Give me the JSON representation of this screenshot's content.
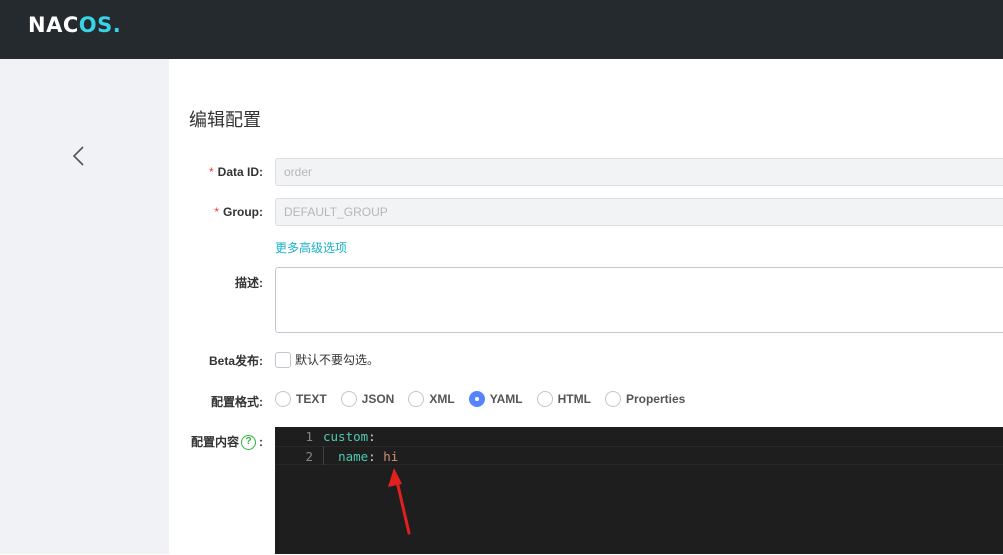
{
  "header": {
    "logo_text_a": "NAC",
    "logo_text_b": "OS",
    "logo_dot": "."
  },
  "sidebar": {
    "back_icon": "chevron-left-icon"
  },
  "page": {
    "title": "编辑配置"
  },
  "form": {
    "data_id": {
      "required_mark": "*",
      "label": "Data ID:",
      "value": "order"
    },
    "group": {
      "required_mark": "*",
      "label": "Group:",
      "value": "DEFAULT_GROUP"
    },
    "advanced_link": "更多高级选项",
    "description": {
      "label": "描述:",
      "value": ""
    },
    "beta": {
      "label": "Beta发布:",
      "checkbox_text": "默认不要勾选。",
      "checked": false
    },
    "format": {
      "label": "配置格式:",
      "options": [
        "TEXT",
        "JSON",
        "XML",
        "YAML",
        "HTML",
        "Properties"
      ],
      "selected": "YAML"
    },
    "content": {
      "label": "配置内容",
      "help_icon": "question-circle-icon",
      "help_glyph": "?",
      "colon": ":"
    }
  },
  "editor": {
    "lines": [
      {
        "no": "1",
        "key": "custom",
        "sep": ":",
        "value": ""
      },
      {
        "no": "2",
        "indent": "  ",
        "key": "name",
        "sep": ": ",
        "value": "hi"
      }
    ]
  },
  "annotation": {
    "arrow_color": "#e0201f"
  },
  "colors": {
    "topbar": "#252a2f",
    "accent_link": "#1ab1ca",
    "radio_selected": "#5584ff",
    "required": "#ff3333",
    "editor_bg": "#1e1e1e"
  }
}
